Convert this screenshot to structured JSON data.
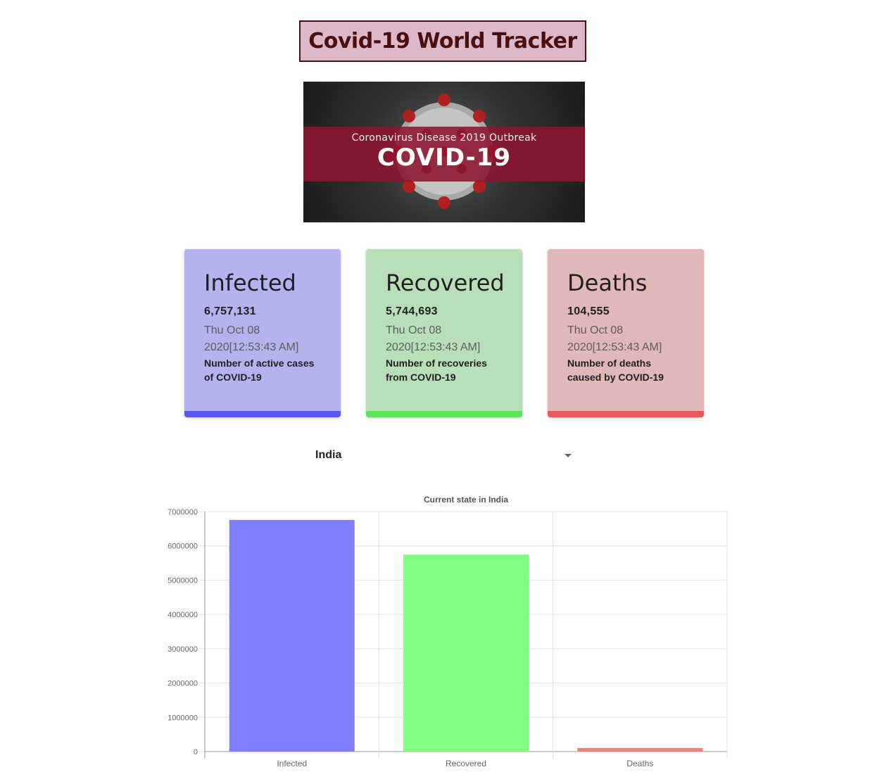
{
  "header": {
    "title": "Covid-19 World Tracker"
  },
  "banner": {
    "subtitle": "Coronavirus Disease 2019 Outbreak",
    "headline": "COVID-19"
  },
  "cards": [
    {
      "label": "Infected",
      "value": "6,757,131",
      "date": "Thu Oct 08 2020[12:53:43 AM]",
      "description": "Number of active cases of COVID-19",
      "stripe_color": "#5757ee"
    },
    {
      "label": "Recovered",
      "value": "5,744,693",
      "date": "Thu Oct 08 2020[12:53:43 AM]",
      "description": "Number of recoveries from COVID-19",
      "stripe_color": "#5be65b"
    },
    {
      "label": "Deaths",
      "value": "104,555",
      "date": "Thu Oct 08 2020[12:53:43 AM]",
      "description": "Number of deaths caused by COVID-19",
      "stripe_color": "#e95a5a"
    }
  ],
  "country_select": {
    "selected": "India"
  },
  "chart_data": {
    "type": "bar",
    "title": "Current state in India",
    "categories": [
      "Infected",
      "Recovered",
      "Deaths"
    ],
    "values": [
      6757131,
      5744693,
      104555
    ],
    "colors": [
      "#8080ff",
      "#80ff80",
      "#f08080"
    ],
    "ylim": [
      0,
      7000000
    ],
    "yticks": [
      "0",
      "1000000",
      "2000000",
      "3000000",
      "4000000",
      "5000000",
      "6000000",
      "7000000"
    ],
    "grid": true,
    "legend": "none"
  }
}
